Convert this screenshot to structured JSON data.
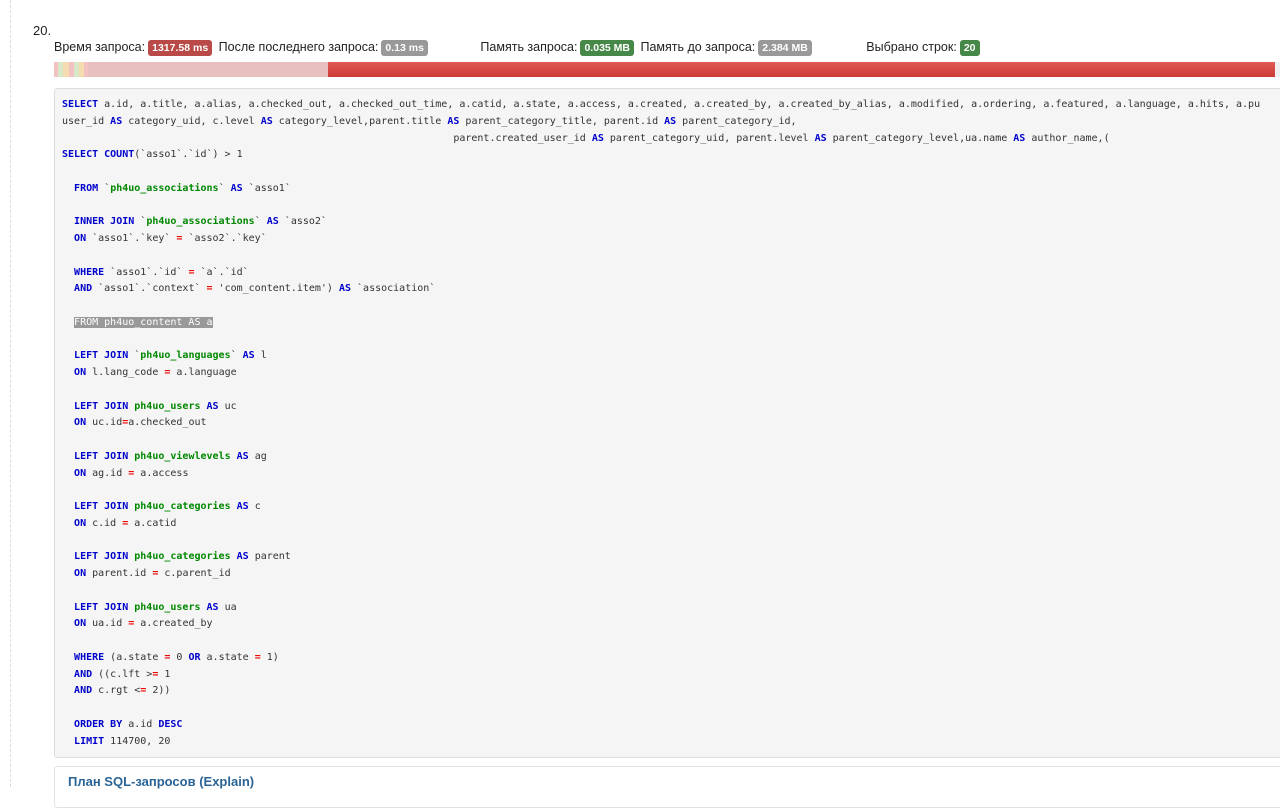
{
  "query": {
    "number": "20.",
    "stats": [
      {
        "label": "Время запроса:",
        "value": "1317.58 ms",
        "color": "#b94a48"
      },
      {
        "label": "После последнего запроса:",
        "value": "0.13 ms",
        "color": "#999999"
      },
      {
        "label": "Память запроса:",
        "value": "0.035 MB",
        "color": "#468847"
      },
      {
        "label": "Память до запроса:",
        "value": "2.384 MB",
        "color": "#999999"
      },
      {
        "label": "Выбрано строк:",
        "value": "20",
        "color": "#468847"
      }
    ],
    "timeline_colors": [
      "#f2c2c2",
      "#d9e8c8",
      "#f5dcb0",
      "#f2c2c2",
      "#d9e8c8",
      "#f5dcb0",
      "#f2c2c2",
      "#e8c0c0",
      "#d9463f"
    ],
    "sql_lines": [
      [
        [
          "k",
          "SELECT"
        ],
        [
          "p",
          " a.id, a.title, a.alias, a.checked_out, a.checked_out_time, a.catid, a.state, a.access, a.created, a.created_by, a.created_by_alias, a.modified, a.ordering, a.featured, a.language, a.hits, a.pu"
        ]
      ],
      [
        [
          "p",
          "user_id "
        ],
        [
          "k",
          "AS"
        ],
        [
          "p",
          " category_uid, c.level "
        ],
        [
          "k",
          "AS"
        ],
        [
          "p",
          " category_level,parent.title "
        ],
        [
          "k",
          "AS"
        ],
        [
          "p",
          " parent_category_title, parent.id "
        ],
        [
          "k",
          "AS"
        ],
        [
          "p",
          " parent_category_id,"
        ]
      ],
      [
        [
          "p",
          "                                                                 parent.created_user_id "
        ],
        [
          "k",
          "AS"
        ],
        [
          "p",
          " parent_category_uid, parent.level "
        ],
        [
          "k",
          "AS"
        ],
        [
          "p",
          " parent_category_level,ua.name "
        ],
        [
          "k",
          "AS"
        ],
        [
          "p",
          " author_name,("
        ]
      ],
      [
        [
          "k",
          "SELECT COUNT"
        ],
        [
          "p",
          "(`asso1`.`id`) > 1"
        ]
      ],
      [],
      [
        [
          "p",
          "  "
        ],
        [
          "k",
          "FROM"
        ],
        [
          "p",
          " `"
        ],
        [
          "t",
          "ph4uo_associations"
        ],
        [
          "p",
          "` "
        ],
        [
          "k",
          "AS"
        ],
        [
          "p",
          " `asso1`"
        ]
      ],
      [],
      [
        [
          "p",
          "  "
        ],
        [
          "k",
          "INNER JOIN"
        ],
        [
          "p",
          " `"
        ],
        [
          "t",
          "ph4uo_associations"
        ],
        [
          "p",
          "` "
        ],
        [
          "k",
          "AS"
        ],
        [
          "p",
          " `asso2`"
        ]
      ],
      [
        [
          "p",
          "  "
        ],
        [
          "k",
          "ON"
        ],
        [
          "p",
          " `asso1`.`key` "
        ],
        [
          "o",
          "="
        ],
        [
          "p",
          " `asso2`.`key`"
        ]
      ],
      [],
      [
        [
          "p",
          "  "
        ],
        [
          "k",
          "WHERE"
        ],
        [
          "p",
          " `asso1`.`id` "
        ],
        [
          "o",
          "="
        ],
        [
          "p",
          " `a`.`id`"
        ]
      ],
      [
        [
          "p",
          "  "
        ],
        [
          "k",
          "AND"
        ],
        [
          "p",
          " `asso1`.`context` "
        ],
        [
          "o",
          "="
        ],
        [
          "p",
          " 'com_content.item') "
        ],
        [
          "k",
          "AS"
        ],
        [
          "p",
          " `association`"
        ]
      ],
      [],
      [
        [
          "p",
          "  "
        ],
        [
          "h",
          "FROM ph4uo_content AS a"
        ]
      ],
      [],
      [
        [
          "p",
          "  "
        ],
        [
          "k",
          "LEFT JOIN"
        ],
        [
          "p",
          " `"
        ],
        [
          "t",
          "ph4uo_languages"
        ],
        [
          "p",
          "` "
        ],
        [
          "k",
          "AS"
        ],
        [
          "p",
          " l"
        ]
      ],
      [
        [
          "p",
          "  "
        ],
        [
          "k",
          "ON"
        ],
        [
          "p",
          " l.lang_code "
        ],
        [
          "o",
          "="
        ],
        [
          "p",
          " a.language"
        ]
      ],
      [],
      [
        [
          "p",
          "  "
        ],
        [
          "k",
          "LEFT JOIN"
        ],
        [
          "p",
          " "
        ],
        [
          "t",
          "ph4uo_users"
        ],
        [
          "p",
          " "
        ],
        [
          "k",
          "AS"
        ],
        [
          "p",
          " uc"
        ]
      ],
      [
        [
          "p",
          "  "
        ],
        [
          "k",
          "ON"
        ],
        [
          "p",
          " uc.id"
        ],
        [
          "o",
          "="
        ],
        [
          "p",
          "a.checked_out"
        ]
      ],
      [],
      [
        [
          "p",
          "  "
        ],
        [
          "k",
          "LEFT JOIN"
        ],
        [
          "p",
          " "
        ],
        [
          "t",
          "ph4uo_viewlevels"
        ],
        [
          "p",
          " "
        ],
        [
          "k",
          "AS"
        ],
        [
          "p",
          " ag"
        ]
      ],
      [
        [
          "p",
          "  "
        ],
        [
          "k",
          "ON"
        ],
        [
          "p",
          " ag.id "
        ],
        [
          "o",
          "="
        ],
        [
          "p",
          " a.access"
        ]
      ],
      [],
      [
        [
          "p",
          "  "
        ],
        [
          "k",
          "LEFT JOIN"
        ],
        [
          "p",
          " "
        ],
        [
          "t",
          "ph4uo_categories"
        ],
        [
          "p",
          " "
        ],
        [
          "k",
          "AS"
        ],
        [
          "p",
          " c"
        ]
      ],
      [
        [
          "p",
          "  "
        ],
        [
          "k",
          "ON"
        ],
        [
          "p",
          " c.id "
        ],
        [
          "o",
          "="
        ],
        [
          "p",
          " a.catid"
        ]
      ],
      [],
      [
        [
          "p",
          "  "
        ],
        [
          "k",
          "LEFT JOIN"
        ],
        [
          "p",
          " "
        ],
        [
          "t",
          "ph4uo_categories"
        ],
        [
          "p",
          " "
        ],
        [
          "k",
          "AS"
        ],
        [
          "p",
          " parent"
        ]
      ],
      [
        [
          "p",
          "  "
        ],
        [
          "k",
          "ON"
        ],
        [
          "p",
          " parent.id "
        ],
        [
          "o",
          "="
        ],
        [
          "p",
          " c.parent_id"
        ]
      ],
      [],
      [
        [
          "p",
          "  "
        ],
        [
          "k",
          "LEFT JOIN"
        ],
        [
          "p",
          " "
        ],
        [
          "t",
          "ph4uo_users"
        ],
        [
          "p",
          " "
        ],
        [
          "k",
          "AS"
        ],
        [
          "p",
          " ua"
        ]
      ],
      [
        [
          "p",
          "  "
        ],
        [
          "k",
          "ON"
        ],
        [
          "p",
          " ua.id "
        ],
        [
          "o",
          "="
        ],
        [
          "p",
          " a.created_by"
        ]
      ],
      [],
      [
        [
          "p",
          "  "
        ],
        [
          "k",
          "WHERE"
        ],
        [
          "p",
          " (a.state "
        ],
        [
          "o",
          "="
        ],
        [
          "p",
          " 0 "
        ],
        [
          "k",
          "OR"
        ],
        [
          "p",
          " a.state "
        ],
        [
          "o",
          "="
        ],
        [
          "p",
          " 1)"
        ]
      ],
      [
        [
          "p",
          "  "
        ],
        [
          "k",
          "AND"
        ],
        [
          "p",
          " ((c.lft >"
        ],
        [
          "o",
          "="
        ],
        [
          "p",
          " 1"
        ]
      ],
      [
        [
          "p",
          "  "
        ],
        [
          "k",
          "AND"
        ],
        [
          "p",
          " c.rgt <"
        ],
        [
          "o",
          "="
        ],
        [
          "p",
          " 2))"
        ]
      ],
      [],
      [
        [
          "p",
          "  "
        ],
        [
          "k",
          "ORDER BY"
        ],
        [
          "p",
          " a.id "
        ],
        [
          "k",
          "DESC"
        ]
      ],
      [
        [
          "p",
          "  "
        ],
        [
          "k",
          "LIMIT"
        ],
        [
          "p",
          " 114700, 20"
        ]
      ]
    ],
    "explain_link": "План SQL-запросов (Explain)"
  }
}
